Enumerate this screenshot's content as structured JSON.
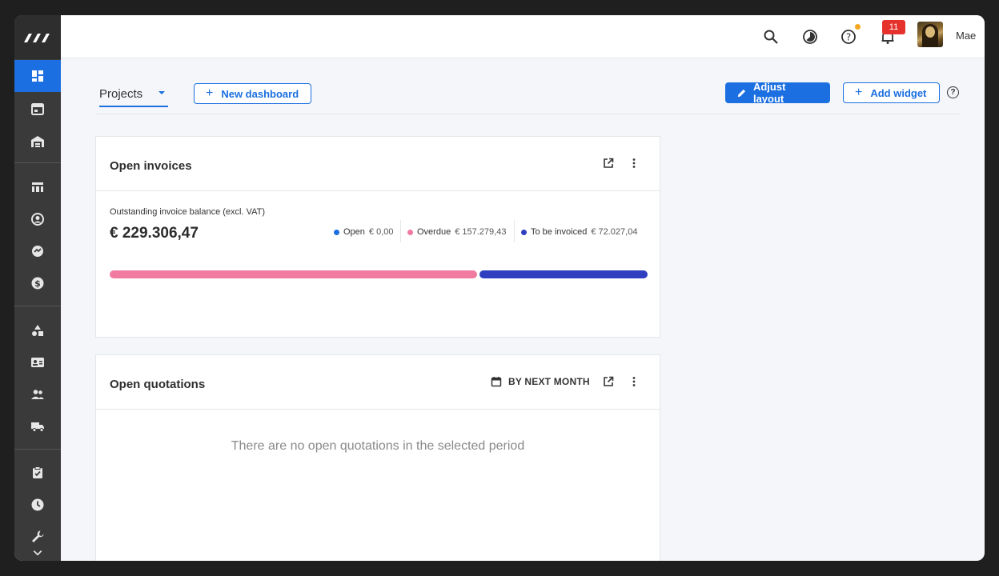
{
  "header": {
    "notification_count": "11",
    "user_name": "Mae"
  },
  "toolbar": {
    "dashboard_tab": "Projects",
    "new_dashboard_label": "New dashboard",
    "adjust_layout_label": "Adjust layout",
    "add_widget_label": "Add widget",
    "help_glyph": "?"
  },
  "invoices": {
    "title": "Open invoices",
    "subtitle": "Outstanding invoice balance (excl. VAT)",
    "total": "€ 229.306,47",
    "legend": [
      {
        "label": "Open",
        "value": "€ 0,00",
        "color": "#1b6fe0"
      },
      {
        "label": "Overdue",
        "value": "€ 157.279,43",
        "color": "#f07aa0"
      },
      {
        "label": "To be invoiced",
        "value": "€ 72.027,04",
        "color": "#2f3fbf"
      }
    ],
    "bar_fractions": {
      "open": 0.0,
      "overdue": 0.686,
      "to_be_invoiced": 0.314
    }
  },
  "quotations": {
    "title": "Open quotations",
    "period_label": "BY NEXT MONTH",
    "empty_message": "There are no open quotations in the selected period"
  },
  "icons": {
    "sidebar": [
      "dashboard-icon",
      "calendar-icon",
      "warehouse-icon",
      "table-icon",
      "contact-icon",
      "handshake-icon",
      "dollar-icon",
      "shapes-icon",
      "id-card-icon",
      "users-icon",
      "truck-icon",
      "task-icon",
      "clock-icon",
      "wrench-icon",
      "chevron-down-icon"
    ],
    "header": [
      "search-icon",
      "timer-icon",
      "help-icon",
      "bell-icon"
    ]
  },
  "colors": {
    "accent": "#1b6fe0",
    "sidebar_bg": "#3a3a3a",
    "badge": "#e5322d"
  }
}
